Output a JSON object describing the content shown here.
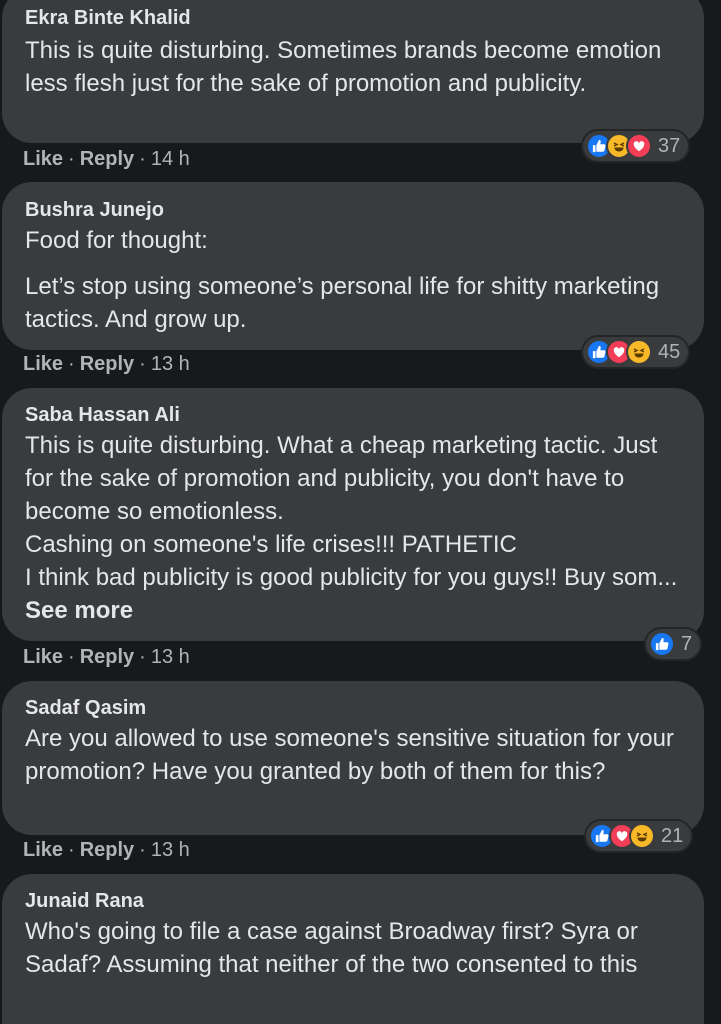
{
  "comments": [
    {
      "author": "Ekra Binte Khalid",
      "lines": [
        "This is quite disturbing. Sometimes brands become emotion less flesh just for the sake of promotion and publicity."
      ],
      "actions": {
        "like": "Like",
        "reply": "Reply",
        "sep": "·",
        "time": "14 h"
      },
      "reactions": {
        "icons": [
          "like-icon",
          "haha-icon",
          "love-icon"
        ],
        "count": "37"
      }
    },
    {
      "author": "Bushra Junejo",
      "lines": [
        "Food for thought:",
        "Let’s stop using someone’s personal life for shitty marketing tactics. And grow up."
      ],
      "actions": {
        "like": "Like",
        "reply": "Reply",
        "sep": "·",
        "time": "13 h"
      },
      "reactions": {
        "icons": [
          "like-icon",
          "love-icon",
          "haha-icon"
        ],
        "count": "45"
      }
    },
    {
      "author": "Saba Hassan Ali",
      "lines": [
        "This is quite disturbing. What a cheap marketing tactic. Just for the sake of promotion and publicity, you don't have to become so emotionless.",
        "Cashing on someone's life crises!!! PATHETIC",
        "I think bad publicity is good publicity for you guys!! Buy som..."
      ],
      "see_more": "See more",
      "actions": {
        "like": "Like",
        "reply": "Reply",
        "sep": "·",
        "time": "13 h"
      },
      "reactions": {
        "icons": [
          "like-icon"
        ],
        "count": "7"
      }
    },
    {
      "author": "Sadaf Qasim",
      "lines": [
        "Are you allowed to use someone's sensitive situation for your promotion? Have you granted by both of them for this?"
      ],
      "actions": {
        "like": "Like",
        "reply": "Reply",
        "sep": "·",
        "time": "13 h"
      },
      "reactions": {
        "icons": [
          "like-icon",
          "love-icon",
          "haha-icon"
        ],
        "count": "21"
      }
    },
    {
      "author": "Junaid Rana",
      "lines": [
        "Who's going to file a case against Broadway first? Syra or Sadaf? Assuming that neither of the two consented to this"
      ]
    }
  ],
  "colors": {
    "background": "#18191a",
    "bubble": "#3a3b3c",
    "text": "#e4e6eb",
    "secondary_text": "#b0b3b8",
    "like": "#1877f2",
    "love": "#f33e58",
    "haha": "#f7b928"
  }
}
